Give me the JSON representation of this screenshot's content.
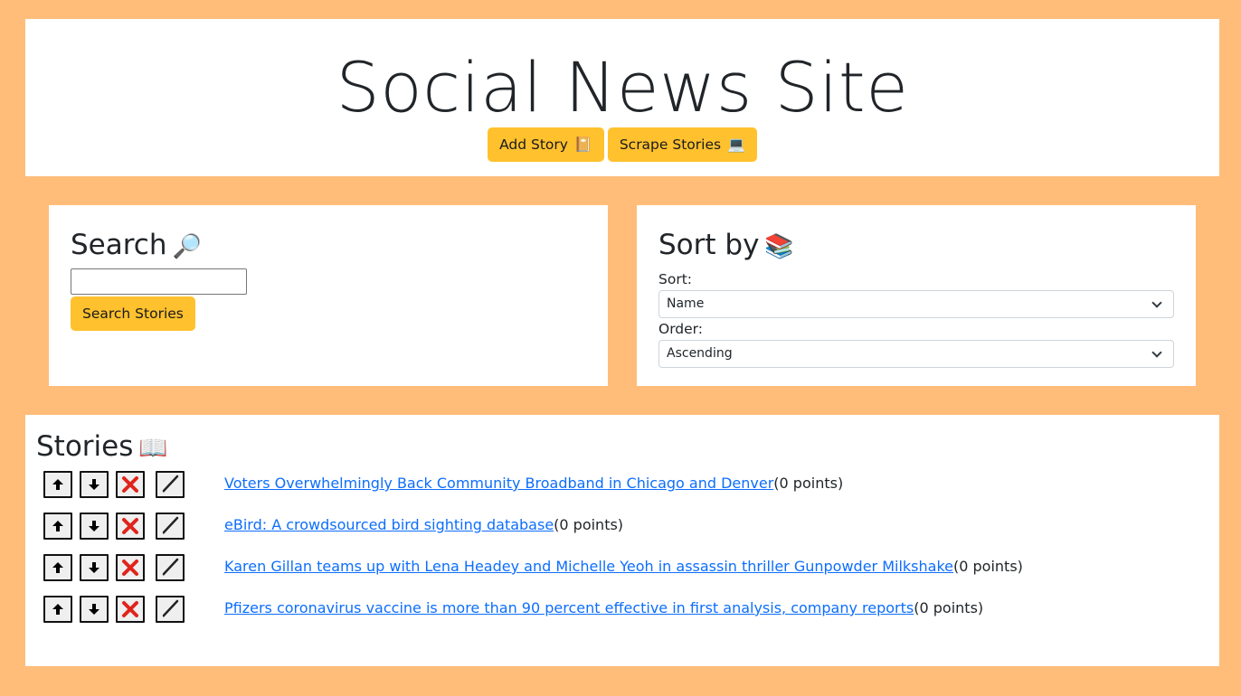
{
  "header": {
    "title": "Social News Site",
    "add_story_label": "Add Story",
    "add_story_emoji": "📔",
    "scrape_label": "Scrape Stories",
    "scrape_emoji": "💻"
  },
  "search": {
    "heading": "Search",
    "heading_emoji": "🔎",
    "input_value": "",
    "button_label": "Search Stories"
  },
  "sort": {
    "heading": "Sort by",
    "heading_emoji": "📚",
    "sort_label": "Sort:",
    "sort_value": "Name",
    "order_label": "Order:",
    "order_value": "Ascending"
  },
  "stories": {
    "heading": "Stories",
    "heading_emoji": "📖",
    "items": [
      {
        "title": "Voters Overwhelmingly Back Community Broadband in Chicago and Denver",
        "points": "(0 points)"
      },
      {
        "title": "eBird: A crowdsourced bird sighting database",
        "points": "(0 points)"
      },
      {
        "title": "Karen Gillan teams up with Lena Headey and Michelle Yeoh in assassin thriller Gunpowder Milkshake",
        "points": "(0 points)"
      },
      {
        "title": "Pfizers coronavirus vaccine is more than 90 percent effective in first analysis, company reports",
        "points": "(0 points)"
      }
    ]
  },
  "icons": {
    "upvote": "arrow-up-icon",
    "downvote": "arrow-down-icon",
    "delete": "cross-icon",
    "edit": "pen-icon"
  },
  "colors": {
    "background": "#ffbd79",
    "button": "#ffc12e",
    "link": "#0d6efd",
    "delete_red": "#e0241b"
  }
}
